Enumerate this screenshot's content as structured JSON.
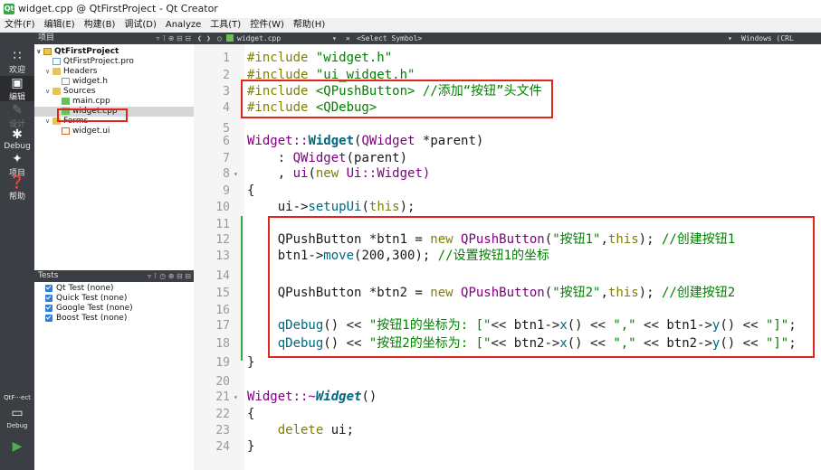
{
  "window": {
    "title": "widget.cpp @ QtFirstProject - Qt Creator"
  },
  "menu": [
    "文件(F)",
    "编辑(E)",
    "构建(B)",
    "调试(D)",
    "Analyze",
    "工具(T)",
    "控件(W)",
    "帮助(H)"
  ],
  "modes": {
    "welcome": "欢迎",
    "edit": "编辑",
    "design": "设计",
    "debug": "Debug",
    "projects": "项目",
    "help": "帮助",
    "target": "QtF···ect",
    "target_mode": "Debug"
  },
  "projects_panel": {
    "title": "项目",
    "tree": {
      "project": "QtFirstProject",
      "pro_file": "QtFirstProject.pro",
      "headers": "Headers",
      "header_file": "widget.h",
      "sources": "Sources",
      "source_main": "main.cpp",
      "source_widget": "widget.cpp",
      "forms": "Forms",
      "form_file": "widget.ui"
    }
  },
  "tests_panel": {
    "title": "Tests",
    "items": [
      "Qt Test (none)",
      "Quick Test (none)",
      "Google Test (none)",
      "Boost Test (none)"
    ]
  },
  "editor_bar": {
    "filename": "widget.cpp",
    "symbol": "<Select Symbol>",
    "encoding": "Windows (CRL"
  },
  "code": {
    "l1": {
      "num": "1",
      "a": "#include ",
      "b": "\"widget.h\""
    },
    "l2": {
      "num": "2",
      "a": "#include ",
      "b": "\"ui_widget.h\""
    },
    "l3": {
      "num": "3",
      "a": "#include ",
      "b": "<QPushButton>",
      "c": " //添加“按钮”头文件"
    },
    "l4": {
      "num": "4",
      "a": "#include ",
      "b": "<QDebug>"
    },
    "l5": {
      "num": "5"
    },
    "l6": {
      "num": "6",
      "a": "Widget::",
      "b": "Widget",
      "c": "(",
      "d": "QWidget",
      "e": " *parent)"
    },
    "l7": {
      "num": "7",
      "a": "    : ",
      "b": "QWidget",
      "c": "(parent)"
    },
    "l8": {
      "num": "8",
      "a": "    , ",
      "b": "ui",
      "c": "(",
      "d": "new",
      "e": " Ui::Widget)"
    },
    "l9": {
      "num": "9",
      "a": "{"
    },
    "l10": {
      "num": "10",
      "a": "    ui->",
      "b": "setupUi",
      "c": "(",
      "d": "this",
      "e": ");"
    },
    "l11": {
      "num": "11"
    },
    "l12": {
      "num": "12",
      "a": "    QPushButton *btn1 = ",
      "b": "new",
      "c": " QPushButton",
      "d": "(",
      "e": "\"按钮1\"",
      "f": ",",
      "g": "this",
      "h": "); ",
      "i": "//创建按钮1"
    },
    "l13": {
      "num": "13",
      "a": "    btn1->",
      "b": "move",
      "c": "(200,300); ",
      "d": "//设置按钮1的坐标"
    },
    "l14": {
      "num": "14"
    },
    "l15": {
      "num": "15",
      "a": "    QPushButton *btn2 = ",
      "b": "new",
      "c": " QPushButton",
      "d": "(",
      "e": "\"按钮2\"",
      "f": ",",
      "g": "this",
      "h": "); ",
      "i": "//创建按钮2"
    },
    "l16": {
      "num": "16"
    },
    "l17": {
      "num": "17",
      "a": "    ",
      "b": "qDebug",
      "c": "() << ",
      "d": "\"按钮1的坐标为: [\"",
      "e": "<< btn1->",
      "f": "x",
      "g": "() << ",
      "h": "\",\"",
      "i": " << btn1->",
      "j": "y",
      "k": "() << ",
      "l": "\"]\"",
      "m": ";"
    },
    "l18": {
      "num": "18",
      "a": "    ",
      "b": "qDebug",
      "c": "() << ",
      "d": "\"按钮2的坐标为: [\"",
      "e": "<< btn2->",
      "f": "x",
      "g": "() << ",
      "h": "\",\"",
      "i": " << btn2->",
      "j": "y",
      "k": "() << ",
      "l": "\"]\"",
      "m": ";"
    },
    "l19": {
      "num": "19",
      "a": "}"
    },
    "l20": {
      "num": "20"
    },
    "l21": {
      "num": "21",
      "a": "Widget::~",
      "b": "Widget",
      "c": "()"
    },
    "l22": {
      "num": "22",
      "a": "{"
    },
    "l23": {
      "num": "23",
      "a": "    ",
      "b": "delete",
      "c": " ui;"
    },
    "l24": {
      "num": "24",
      "a": "}"
    }
  },
  "colors": {
    "annotation_box": "#e0251b",
    "mode_bar": "#3b3e42",
    "change_marker": "#2fa84a"
  }
}
